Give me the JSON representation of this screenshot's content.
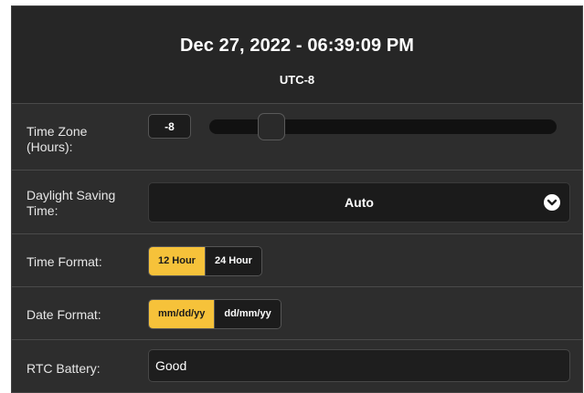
{
  "header": {
    "datetime": "Dec 27, 2022 - 06:39:09 PM",
    "timezone_label": "UTC-8"
  },
  "time_zone": {
    "label_line1": "Time Zone",
    "label_line2": "(Hours):",
    "value": "-8",
    "slider_fraction": 0.15
  },
  "dst": {
    "label_line1": "Daylight Saving",
    "label_line2": "Time:",
    "selected": "Auto",
    "icon": "chevron-down-icon"
  },
  "time_format": {
    "label": "Time Format:",
    "options": [
      "12 Hour",
      "24 Hour"
    ],
    "selected": "12 Hour"
  },
  "date_format": {
    "label": "Date Format:",
    "options": [
      "mm/dd/yy",
      "dd/mm/yy"
    ],
    "selected": "mm/dd/yy"
  },
  "rtc_battery": {
    "label": "RTC Battery:",
    "value": "Good"
  },
  "colors": {
    "accent": "#f6c23a",
    "panel": "#2c2c2c",
    "field": "#1c1c1c"
  }
}
